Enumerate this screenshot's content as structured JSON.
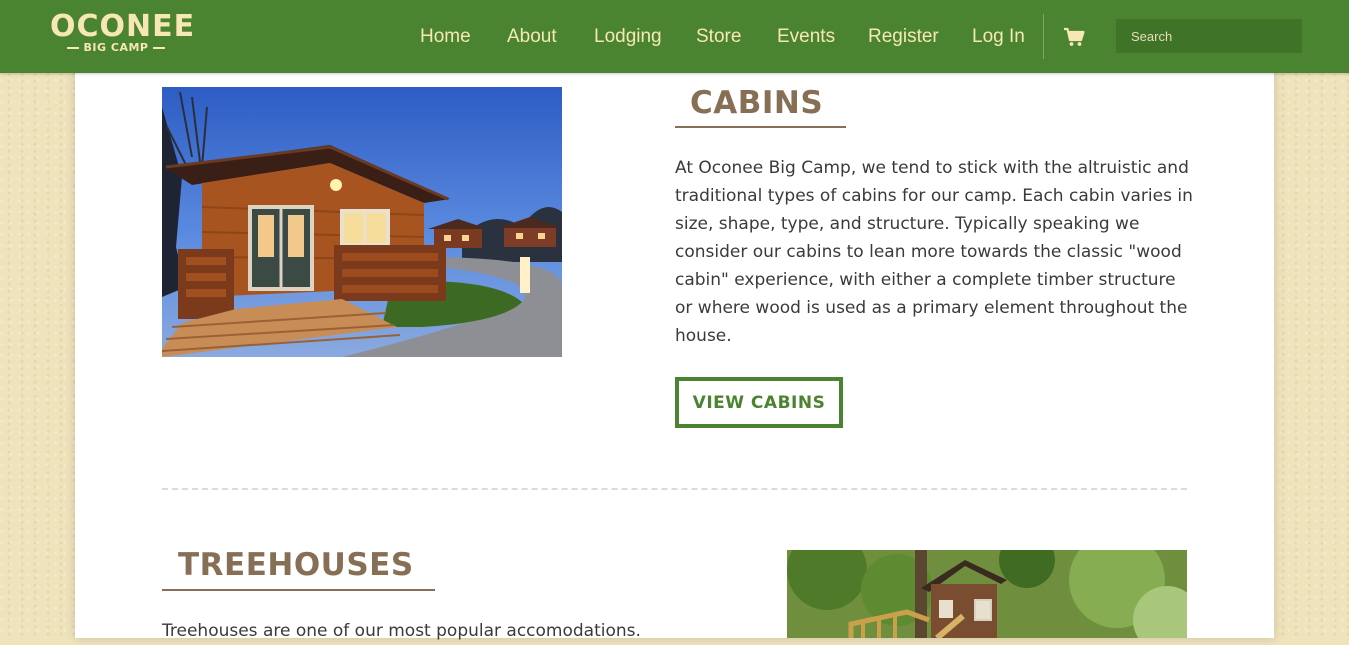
{
  "brand": {
    "title": "OCONEE",
    "subtitle": "BIG CAMP",
    "color_text": "#f6e7b5",
    "color_bar": "#4b8430"
  },
  "nav": {
    "items": [
      {
        "label": "Home"
      },
      {
        "label": "About"
      },
      {
        "label": "Lodging"
      },
      {
        "label": "Store"
      },
      {
        "label": "Events"
      },
      {
        "label": "Register"
      },
      {
        "label": "Log In"
      }
    ],
    "cart_icon": "shopping-cart-icon",
    "search_placeholder": "Search",
    "search_value": ""
  },
  "sections": {
    "cabins": {
      "heading": "CABINS",
      "description": "At Oconee Big Camp, we tend to stick with the altruistic and traditional types of cabins for our camp. Each cabin varies in size, shape, type, and structure. Typically speaking we consider our cabins to lean more towards the classic \"wood cabin\" experience, with either a complete timber structure or where wood is used as a primary element throughout the house.",
      "button": "VIEW CABINS"
    },
    "treehouses": {
      "heading": "TREEHOUSES",
      "description": "Treehouses are one of our most popular accomodations."
    }
  },
  "colors": {
    "accent_green": "#4b8430",
    "heading_brown": "#876f56",
    "page_background": "#efe3bb"
  }
}
